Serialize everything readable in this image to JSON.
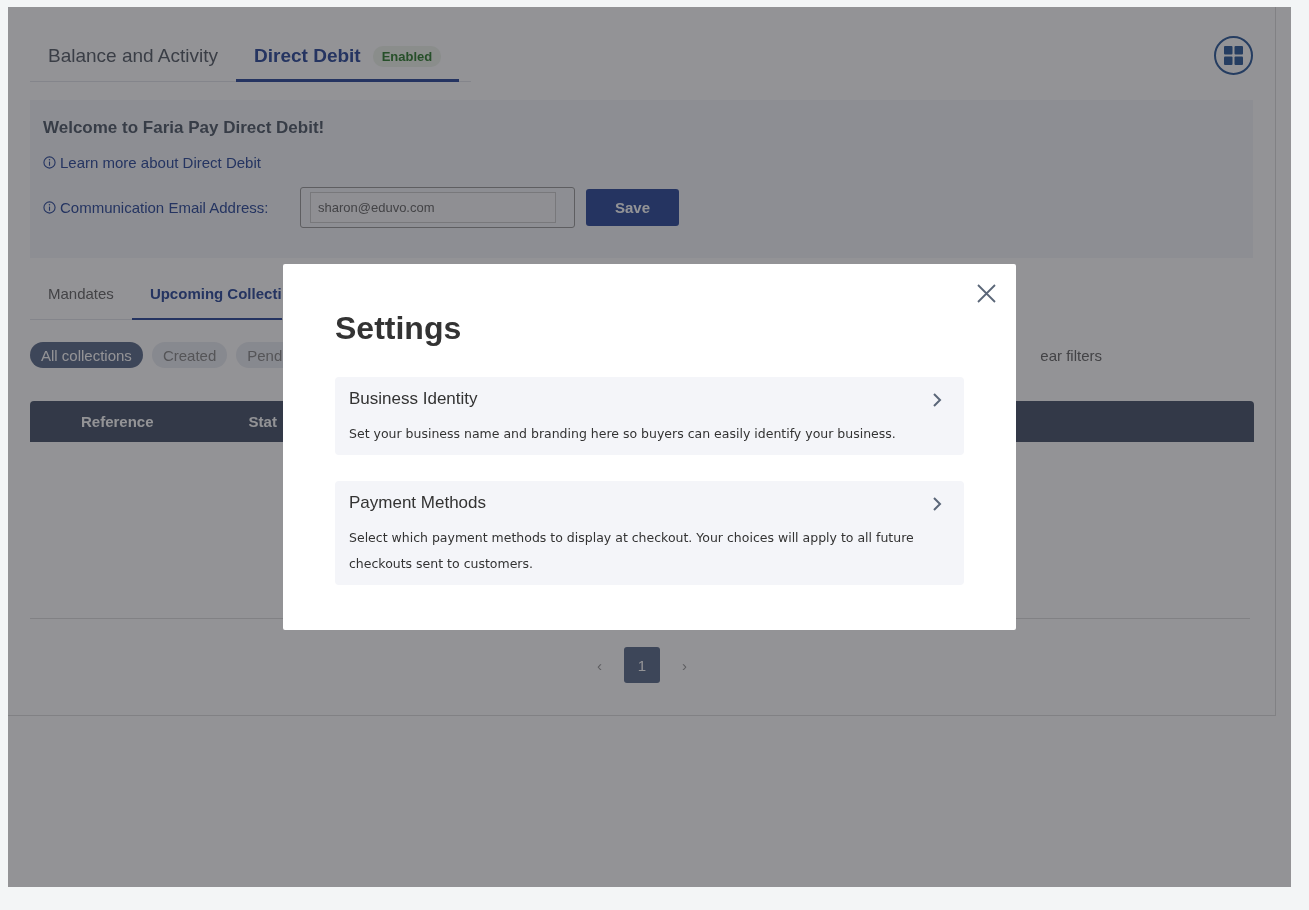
{
  "tabs": [
    {
      "label": "Balance and Activity",
      "selected": false
    },
    {
      "label": "Direct Debit",
      "selected": true,
      "badge": "Enabled"
    }
  ],
  "welcome": {
    "title": "Welcome to Faria Pay Direct Debit!",
    "link": "Learn more about Direct Debit",
    "email_label": "Communication Email Address:",
    "email_value": "sharon@eduvo.com",
    "save_button": "Save"
  },
  "subtabs": [
    {
      "label": "Mandates",
      "selected": false
    },
    {
      "label": "Upcoming Collecti",
      "selected": true
    }
  ],
  "filters": [
    {
      "label": "All collections",
      "selected": true
    },
    {
      "label": "Created",
      "selected": false
    },
    {
      "label": "Pend",
      "selected": false
    }
  ],
  "clear_filters": "ear filters",
  "table": {
    "columns": [
      "Reference",
      "Stat"
    ]
  },
  "pagination": {
    "prev": "‹",
    "next": "›",
    "pages": [
      {
        "label": "1",
        "selected": true
      }
    ]
  },
  "modal": {
    "title": "Settings",
    "items": [
      {
        "title": "Business Identity",
        "description": "Set your business name and branding here so buyers can easily identify your business."
      },
      {
        "title": "Payment Methods",
        "description": "Select which payment methods to display at checkout. Your choices will apply to all future checkouts sent to customers."
      }
    ]
  }
}
